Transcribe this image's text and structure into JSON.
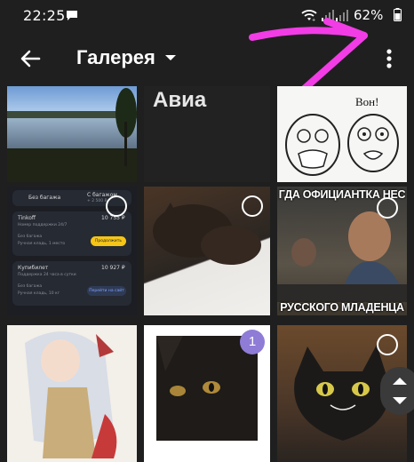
{
  "status_bar": {
    "time": "22:25",
    "battery": "62%"
  },
  "app_bar": {
    "title": "Галерея"
  },
  "gallery": {
    "tiles": [
      {
        "name": "Lake landscape photo",
        "selected": false
      },
      {
        "name": "Avia screenshot",
        "text": "Авиа",
        "selected": false
      },
      {
        "name": "Rage comic",
        "text": "Вон!",
        "selected": false
      },
      {
        "name": "Flight booking screenshot",
        "selected": false,
        "booking": {
          "tab1": "Без багажа",
          "tab2": "С багажом",
          "tab2_price": "+ 2 500 ₽",
          "card1": {
            "title": "Tinkoff",
            "sub": "Номер поддержки 24/7",
            "price": "10 755 ₽",
            "line1": "Без багажа",
            "line2": "Ручная кладь, 1 место",
            "action": "Продолжить"
          },
          "card2": {
            "title": "Купибилет",
            "sub": "Поддержка 24 часа в сутки",
            "price": "10 927 ₽",
            "line1": "Без багажа",
            "line2": "Ручная кладь, 10 кг",
            "action": "Перейти на сайт"
          }
        }
      },
      {
        "name": "Sleeping cat photo",
        "selected": false
      },
      {
        "name": "Laughing man meme",
        "text_top": "ГДА ОФИЦИАНТКА НЕС",
        "text_bottom": "РУССКОГО МЛАДЕНЦА",
        "selected": false
      },
      {
        "name": "Anime character art",
        "selected": false
      },
      {
        "name": "Black cat close-up",
        "selected": true,
        "selection_number": "1"
      },
      {
        "name": "Black cat with yellow eyes",
        "selected": false
      }
    ]
  },
  "colors": {
    "background": "#1f1f1f",
    "selection": "#8e7cd6",
    "annotation": "#f23ce6"
  }
}
